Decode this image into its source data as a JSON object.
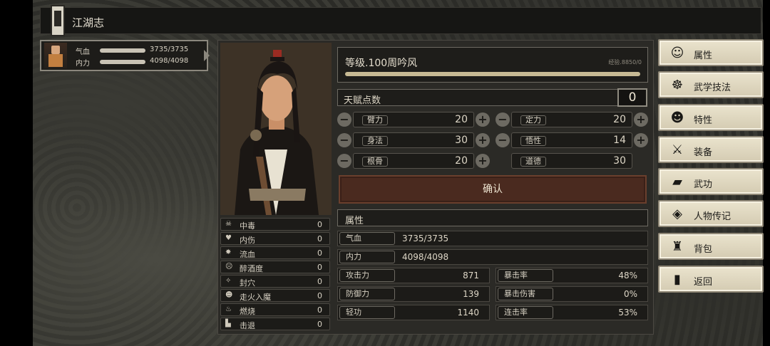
{
  "header": {
    "title": "江湖志"
  },
  "hp_box": {
    "hp_label": "气血",
    "hp_value": "3735/3735",
    "hp_fill": 1.0,
    "mp_label": "内力",
    "mp_value": "4098/4098",
    "mp_fill": 1.0
  },
  "status_effects": [
    {
      "icon": "skull-icon",
      "glyph": "☠",
      "name": "中毒",
      "value": "0"
    },
    {
      "icon": "broken-heart-icon",
      "glyph": "♥",
      "name": "内伤",
      "value": "0"
    },
    {
      "icon": "blood-drop-icon",
      "glyph": "✸",
      "name": "流血",
      "value": "0"
    },
    {
      "icon": "drunk-face-icon",
      "glyph": "☹",
      "name": "醉酒度",
      "value": "0"
    },
    {
      "icon": "acupoint-icon",
      "glyph": "✧",
      "name": "封穴",
      "value": "0"
    },
    {
      "icon": "demon-face-icon",
      "glyph": "☻",
      "name": "走火入魔",
      "value": "0"
    },
    {
      "icon": "flame-icon",
      "glyph": "♨",
      "name": "燃烧",
      "value": "0"
    },
    {
      "icon": "knockback-icon",
      "glyph": "▙",
      "name": "击退",
      "value": "0"
    }
  ],
  "level": {
    "title": "等级.100周吟风",
    "exp_text": "经验.8850/0",
    "exp_fill": 1.0
  },
  "talent": {
    "label": "天赋点数",
    "value": "0"
  },
  "stats": [
    {
      "label": "臂力",
      "value": "20",
      "adjustable": true
    },
    {
      "label": "定力",
      "value": "20",
      "adjustable": true
    },
    {
      "label": "身法",
      "value": "30",
      "adjustable": true
    },
    {
      "label": "悟性",
      "value": "14",
      "adjustable": true
    },
    {
      "label": "根骨",
      "value": "20",
      "adjustable": true
    },
    {
      "label": "道德",
      "value": "30",
      "adjustable": false
    }
  ],
  "confirm_label": "确认",
  "attributes": {
    "header": "属性",
    "hp": {
      "label": "气血",
      "value": "3735/3735"
    },
    "mp": {
      "label": "内力",
      "value": "4098/4098"
    },
    "attack": {
      "label": "攻击力",
      "value": "871"
    },
    "crit_rate": {
      "label": "暴击率",
      "value": "48%"
    },
    "defense": {
      "label": "防御力",
      "value": "139"
    },
    "crit_damage": {
      "label": "暴击伤害",
      "value": "0%"
    },
    "qinggong": {
      "label": "轻功",
      "value": "1140"
    },
    "combo_rate": {
      "label": "连击率",
      "value": "53%"
    }
  },
  "menu": [
    {
      "icon": "person-icon",
      "glyph": "☺",
      "label": "属性"
    },
    {
      "icon": "martial-skill-icon",
      "glyph": "☸",
      "label": "武学技法"
    },
    {
      "icon": "trait-icon",
      "glyph": "☻",
      "label": "特性"
    },
    {
      "icon": "sword-icon",
      "glyph": "⚔",
      "label": "装备"
    },
    {
      "icon": "scroll-book-icon",
      "glyph": "▰",
      "label": "武功"
    },
    {
      "icon": "biography-icon",
      "glyph": "◈",
      "label": "人物传记"
    },
    {
      "icon": "bag-icon",
      "glyph": "♜",
      "label": "背包"
    },
    {
      "icon": "door-icon",
      "glyph": "▮",
      "label": "返回"
    }
  ],
  "colors": {
    "accent_confirm": "#4a2a1f",
    "menu_bg": "#e2dac2",
    "panel_bg": "#2b2a26"
  }
}
